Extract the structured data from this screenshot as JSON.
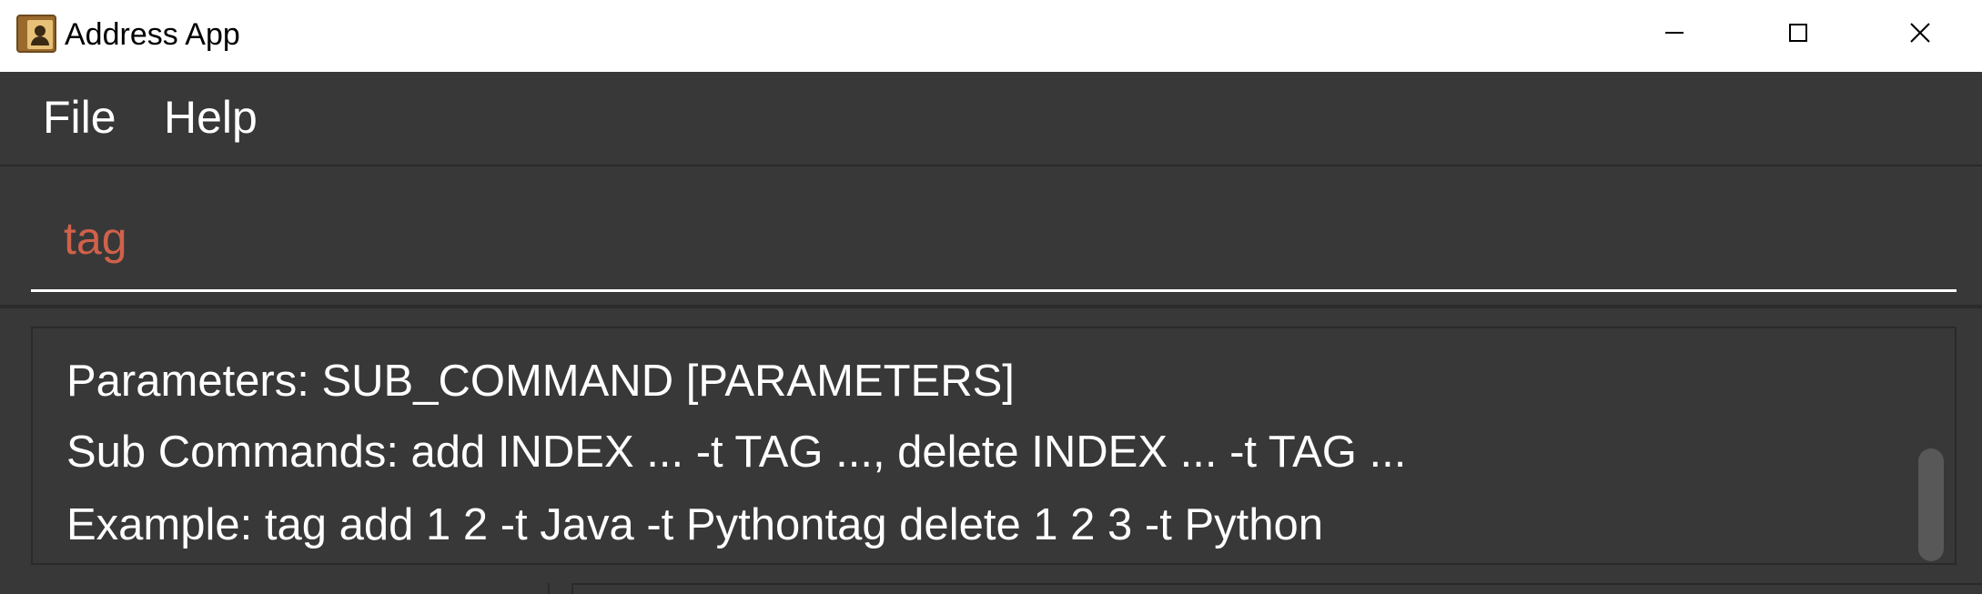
{
  "window": {
    "title": "Address App",
    "app_icon": "address-book-icon",
    "controls": {
      "minimize_icon": "minimize-icon",
      "maximize_icon": "maximize-icon",
      "close_icon": "close-icon"
    }
  },
  "menu": {
    "items": [
      {
        "label": "File"
      },
      {
        "label": "Help"
      }
    ]
  },
  "command": {
    "value": "tag",
    "text_color": "#d0614a"
  },
  "result": {
    "lines": [
      "Parameters: SUB_COMMAND [PARAMETERS]",
      "Sub Commands: add INDEX ... -t TAG ..., delete INDEX ... -t TAG ...",
      "Example: tag add 1 2 -t Java -t Pythontag delete 1 2 3 -t Python"
    ]
  },
  "theme": {
    "background": "#383838",
    "border": "#2a2a2a",
    "text": "#ffffff"
  }
}
